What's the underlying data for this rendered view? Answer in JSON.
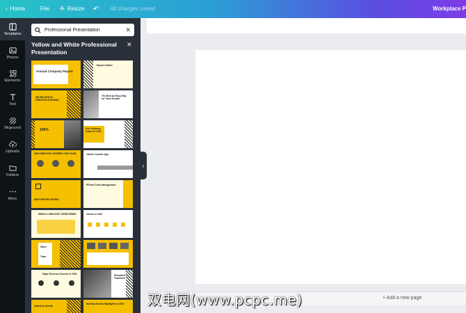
{
  "topbar": {
    "home": "Home",
    "file": "File",
    "resize": "Resize",
    "status": "All changes saved",
    "doc_title": "Workplace P"
  },
  "rail": {
    "items": [
      {
        "label": "Templates",
        "icon": "templates-icon"
      },
      {
        "label": "Photos",
        "icon": "photos-icon"
      },
      {
        "label": "Elements",
        "icon": "elements-icon"
      },
      {
        "label": "Text",
        "icon": "text-icon"
      },
      {
        "label": "Bkground",
        "icon": "background-icon"
      },
      {
        "label": "Uploads",
        "icon": "uploads-icon"
      },
      {
        "label": "Folders",
        "icon": "folders-icon"
      },
      {
        "label": "More",
        "icon": "more-icon"
      }
    ]
  },
  "panel": {
    "search_value": "Professional Presentation",
    "title": "Yellow and White Professional Presentation",
    "templates": [
      {
        "title": "Annual Company Report"
      },
      {
        "title": "Report Outline"
      },
      {
        "title": "WE BELIEVE IN CREATIVE ECONOMY"
      },
      {
        "title": "The Best (& Easy) Way for Team Growth"
      },
      {
        "title": "100%"
      },
      {
        "title": "Our Company Goals for 2020"
      },
      {
        "title": "NEW SERVICES OFFERED THIS YEAR"
      },
      {
        "title": "Calorie Counter App"
      },
      {
        "title": "NEW OPPORTUNITIES"
      },
      {
        "title": "PR and Crisis Management"
      },
      {
        "title": "WEEKLY SERVICES TERRITORIES"
      },
      {
        "title": "Clients in 2020"
      },
      {
        "title": "Sales"
      },
      {
        "title": "Team"
      },
      {
        "title": "Major Revenue Sources in 2020"
      },
      {
        "title": "Workplace Teamwork"
      },
      {
        "title": "Quarterly Growth"
      },
      {
        "title": "Monthly Growth Highlights in 2020"
      }
    ]
  },
  "canvas": {
    "add_page": "+ Add a new page"
  },
  "watermark": "双电网(www.pcpc.me)",
  "colors": {
    "accent_yellow": "#f5c000",
    "panel_bg": "#293039",
    "rail_bg": "#0e1318"
  }
}
